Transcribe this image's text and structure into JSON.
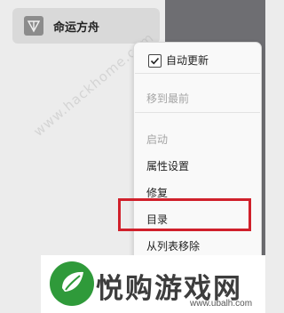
{
  "sidebar": {
    "game": {
      "name": "命运方舟",
      "icon": "game-emblem-icon"
    }
  },
  "watermark": "www.hackhome.com",
  "context_menu": {
    "items": [
      {
        "label": "自动更新",
        "checked": true,
        "disabled": false
      },
      {
        "label": "移到最前",
        "disabled": true
      },
      {
        "label": "启动",
        "disabled": true
      },
      {
        "label": "属性设置",
        "disabled": false
      },
      {
        "label": "修复",
        "disabled": false
      },
      {
        "label": "目录",
        "disabled": false,
        "highlighted": true
      },
      {
        "label": "从列表移除",
        "disabled": false
      }
    ],
    "highlight_color": "#d0202b"
  },
  "logo": {
    "brand": "悦购游戏网",
    "url": "www.ubalh.com",
    "color": "#2f9a3a"
  }
}
